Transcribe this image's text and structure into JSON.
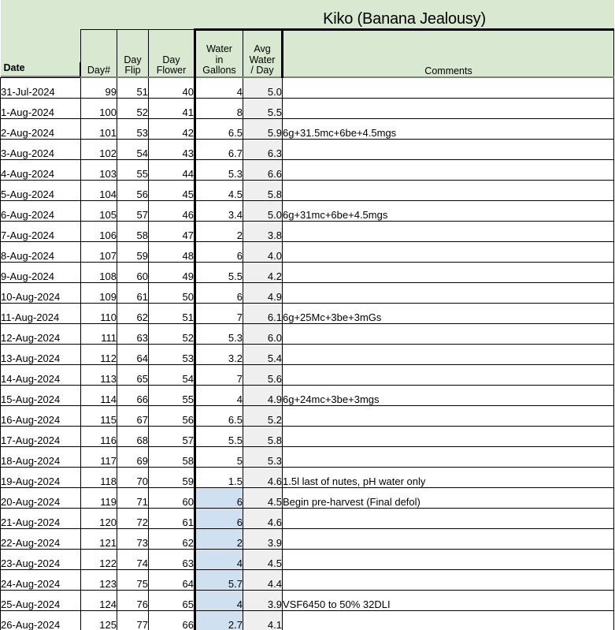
{
  "sheet": {
    "title": "Kiko (Banana Jealousy)",
    "colors": {
      "header_green": "#d9e8d0",
      "highlight_blue": "#cfe0f0",
      "avg_gray": "#f0efef",
      "grid_line": "#000000"
    }
  },
  "columns": {
    "date": "Date",
    "day_num": "Day#",
    "day_flip": "Day\nFlip",
    "day_flip_line1": "Day",
    "day_flip_line2": "Flip",
    "day_flower_line1": "Day",
    "day_flower_line2": "Flower",
    "water_line1": "Water",
    "water_line2": "in",
    "water_line3": "Gallons",
    "avg_line1": "Avg",
    "avg_line2": "Water",
    "avg_line3": "/ Day",
    "comments": "Comments"
  },
  "rows": [
    {
      "date": "31-Jul-2024",
      "day": "99",
      "flip": "51",
      "flower": "40",
      "water": "4",
      "avg": "5.0",
      "comment": "",
      "highlight": false
    },
    {
      "date": "1-Aug-2024",
      "day": "100",
      "flip": "52",
      "flower": "41",
      "water": "8",
      "avg": "5.5",
      "comment": "",
      "highlight": false
    },
    {
      "date": "2-Aug-2024",
      "day": "101",
      "flip": "53",
      "flower": "42",
      "water": "6.5",
      "avg": "5.9",
      "comment": "6g+31.5mc+6be+4.5mgs",
      "highlight": false
    },
    {
      "date": "3-Aug-2024",
      "day": "102",
      "flip": "54",
      "flower": "43",
      "water": "6.7",
      "avg": "6.3",
      "comment": "",
      "highlight": false
    },
    {
      "date": "4-Aug-2024",
      "day": "103",
      "flip": "55",
      "flower": "44",
      "water": "5.3",
      "avg": "6.6",
      "comment": "",
      "highlight": false
    },
    {
      "date": "5-Aug-2024",
      "day": "104",
      "flip": "56",
      "flower": "45",
      "water": "4.5",
      "avg": "5.8",
      "comment": "",
      "highlight": false
    },
    {
      "date": "6-Aug-2024",
      "day": "105",
      "flip": "57",
      "flower": "46",
      "water": "3.4",
      "avg": "5.0",
      "comment": "6g+31mc+6be+4.5mgs",
      "highlight": false
    },
    {
      "date": "7-Aug-2024",
      "day": "106",
      "flip": "58",
      "flower": "47",
      "water": "2",
      "avg": "3.8",
      "comment": "",
      "highlight": false
    },
    {
      "date": "8-Aug-2024",
      "day": "107",
      "flip": "59",
      "flower": "48",
      "water": "6",
      "avg": "4.0",
      "comment": "",
      "highlight": false
    },
    {
      "date": "9-Aug-2024",
      "day": "108",
      "flip": "60",
      "flower": "49",
      "water": "5.5",
      "avg": "4.2",
      "comment": "",
      "highlight": false
    },
    {
      "date": "10-Aug-2024",
      "day": "109",
      "flip": "61",
      "flower": "50",
      "water": "6",
      "avg": "4.9",
      "comment": "",
      "highlight": false
    },
    {
      "date": "11-Aug-2024",
      "day": "110",
      "flip": "62",
      "flower": "51",
      "water": "7",
      "avg": "6.1",
      "comment": "6g+25Mc+3be+3mGs",
      "highlight": false
    },
    {
      "date": "12-Aug-2024",
      "day": "111",
      "flip": "63",
      "flower": "52",
      "water": "5.3",
      "avg": "6.0",
      "comment": "",
      "highlight": false
    },
    {
      "date": "13-Aug-2024",
      "day": "112",
      "flip": "64",
      "flower": "53",
      "water": "3.2",
      "avg": "5.4",
      "comment": "",
      "highlight": false
    },
    {
      "date": "14-Aug-2024",
      "day": "113",
      "flip": "65",
      "flower": "54",
      "water": "7",
      "avg": "5.6",
      "comment": "",
      "highlight": false
    },
    {
      "date": "15-Aug-2024",
      "day": "114",
      "flip": "66",
      "flower": "55",
      "water": "4",
      "avg": "4.9",
      "comment": "6g+24mc+3be+3mgs",
      "highlight": false
    },
    {
      "date": "16-Aug-2024",
      "day": "115",
      "flip": "67",
      "flower": "56",
      "water": "6.5",
      "avg": "5.2",
      "comment": "",
      "highlight": false
    },
    {
      "date": "17-Aug-2024",
      "day": "116",
      "flip": "68",
      "flower": "57",
      "water": "5.5",
      "avg": "5.8",
      "comment": "",
      "highlight": false
    },
    {
      "date": "18-Aug-2024",
      "day": "117",
      "flip": "69",
      "flower": "58",
      "water": "5",
      "avg": "5.3",
      "comment": "",
      "highlight": false
    },
    {
      "date": "19-Aug-2024",
      "day": "118",
      "flip": "70",
      "flower": "59",
      "water": "1.5",
      "avg": "4.6",
      "comment": "1.5l last of nutes, pH water only",
      "highlight": false
    },
    {
      "date": "20-Aug-2024",
      "day": "119",
      "flip": "71",
      "flower": "60",
      "water": "6",
      "avg": "4.5",
      "comment": "Begin pre-harvest (Final defol)",
      "highlight": true
    },
    {
      "date": "21-Aug-2024",
      "day": "120",
      "flip": "72",
      "flower": "61",
      "water": "6",
      "avg": "4.6",
      "comment": "",
      "highlight": true
    },
    {
      "date": "22-Aug-2024",
      "day": "121",
      "flip": "73",
      "flower": "62",
      "water": "2",
      "avg": "3.9",
      "comment": "",
      "highlight": true
    },
    {
      "date": "23-Aug-2024",
      "day": "122",
      "flip": "74",
      "flower": "63",
      "water": "4",
      "avg": "4.5",
      "comment": "",
      "highlight": true
    },
    {
      "date": "24-Aug-2024",
      "day": "123",
      "flip": "75",
      "flower": "64",
      "water": "5.7",
      "avg": "4.4",
      "comment": "",
      "highlight": true
    },
    {
      "date": "25-Aug-2024",
      "day": "124",
      "flip": "76",
      "flower": "65",
      "water": "4",
      "avg": "3.9",
      "comment": "VSF6450 to 50% 32DLI",
      "highlight": true
    },
    {
      "date": "26-Aug-2024",
      "day": "125",
      "flip": "77",
      "flower": "66",
      "water": "2.7",
      "avg": "4.1",
      "comment": "",
      "highlight": true
    }
  ]
}
